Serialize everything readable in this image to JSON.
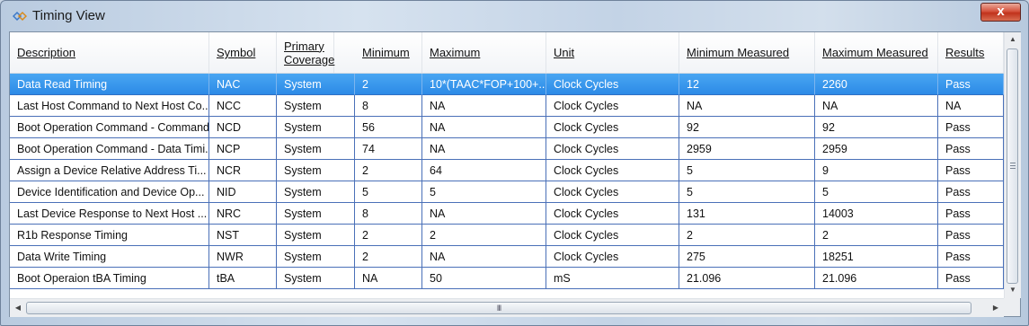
{
  "window": {
    "title": "Timing View",
    "close_label": "x"
  },
  "columns": [
    "Description",
    "Symbol",
    "Primary Coverage",
    "Minimum",
    "Maximum",
    "Unit",
    "Minimum Measured",
    "Maximum Measured",
    "Results"
  ],
  "rows": [
    [
      "Data Read Timing",
      "NAC",
      "System",
      "2",
      "10*(TAAC*FOP+100+...",
      "Clock Cycles",
      "12",
      "2260",
      "Pass"
    ],
    [
      "Last Host Command to Next Host Co...",
      "NCC",
      "System",
      "8",
      "NA",
      "Clock Cycles",
      "NA",
      "NA",
      "NA"
    ],
    [
      "Boot Operation Command - Command...",
      "NCD",
      "System",
      "56",
      "NA",
      "Clock Cycles",
      "92",
      "92",
      "Pass"
    ],
    [
      "Boot Operation Command - Data Timi...",
      "NCP",
      "System",
      "74",
      "NA",
      "Clock Cycles",
      "2959",
      "2959",
      "Pass"
    ],
    [
      "Assign a Device Relative Address Ti...",
      "NCR",
      "System",
      "2",
      "64",
      "Clock Cycles",
      "5",
      "9",
      "Pass"
    ],
    [
      "Device Identification and Device Op...",
      "NID",
      "System",
      "5",
      "5",
      "Clock Cycles",
      "5",
      "5",
      "Pass"
    ],
    [
      "Last Device Response to Next Host ...",
      "NRC",
      "System",
      "8",
      "NA",
      "Clock Cycles",
      "131",
      "14003",
      "Pass"
    ],
    [
      "R1b Response Timing",
      "NST",
      "System",
      "2",
      "2",
      "Clock Cycles",
      "2",
      "2",
      "Pass"
    ],
    [
      "Data Write Timing",
      "NWR",
      "System",
      "2",
      "NA",
      "Clock Cycles",
      "275",
      "18251",
      "Pass"
    ],
    [
      "Boot Operaion tBA Timing",
      "tBA",
      "System",
      "NA",
      "50",
      "mS",
      "21.096",
      "21.096",
      "Pass"
    ]
  ],
  "selected_row": 0,
  "scroll": {
    "vertical_grip": "≡",
    "horizontal_grip": "III"
  },
  "colors": {
    "selection": "#3399ee",
    "grid_line": "#4a70b8",
    "close_button": "#c7432b"
  },
  "icons": {
    "app": "timing-view-icon",
    "up": "scroll-up-arrow-icon",
    "down": "scroll-down-arrow-icon",
    "left": "scroll-left-arrow-icon",
    "right": "scroll-right-arrow-icon"
  }
}
